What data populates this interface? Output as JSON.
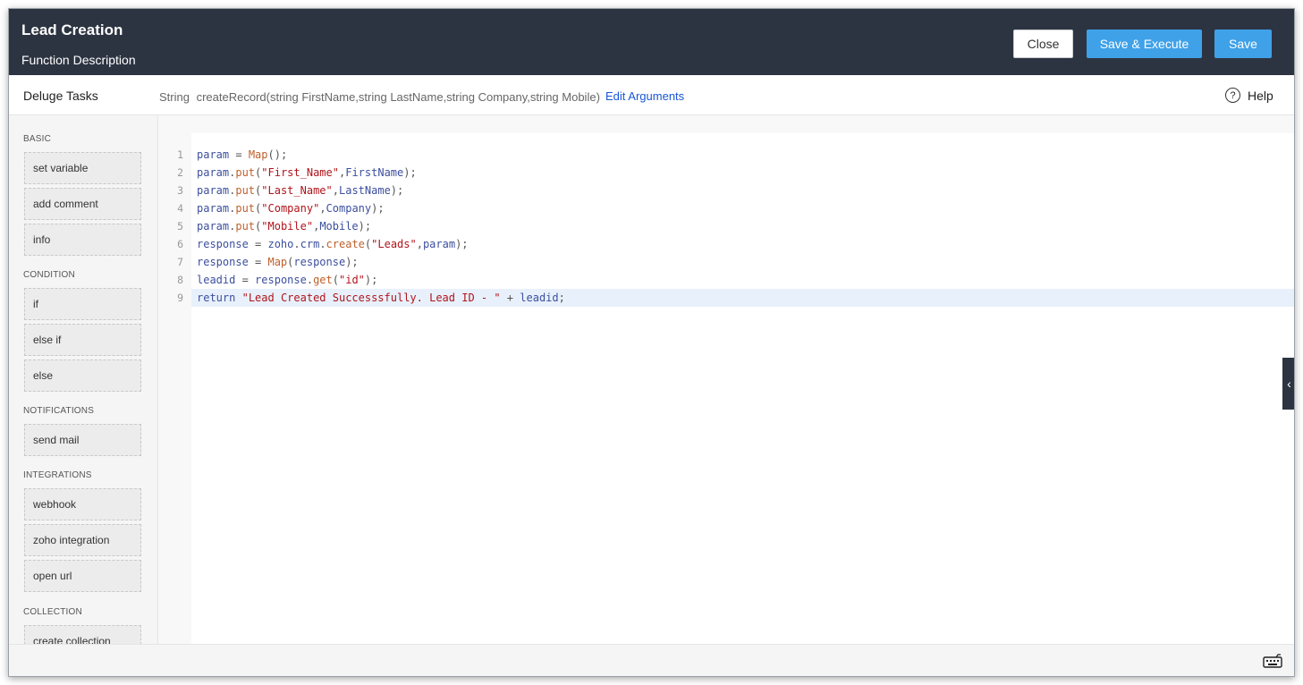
{
  "header": {
    "title": "Lead Creation",
    "subtitle": "Function Description",
    "close_label": "Close",
    "save_execute_label": "Save & Execute",
    "save_label": "Save"
  },
  "subbar": {
    "panel_title": "Deluge Tasks",
    "return_type": "String",
    "signature": "createRecord(string FirstName,string LastName,string Company,string Mobile)",
    "edit_arguments_label": "Edit Arguments",
    "help_label": "Help",
    "help_icon_glyph": "?"
  },
  "sidebar": {
    "groups": [
      {
        "title": "BASIC",
        "items": [
          "set variable",
          "add comment",
          "info"
        ]
      },
      {
        "title": "CONDITION",
        "items": [
          "if",
          "else if",
          "else"
        ]
      },
      {
        "title": "NOTIFICATIONS",
        "items": [
          "send mail"
        ]
      },
      {
        "title": "INTEGRATIONS",
        "items": [
          "webhook",
          "zoho integration",
          "open url"
        ]
      },
      {
        "title": "COLLECTION",
        "items": [
          "create collection"
        ]
      }
    ]
  },
  "editor": {
    "active_line": 9,
    "lines": [
      "param = Map();",
      "param.put(\"First_Name\",FirstName);",
      "param.put(\"Last_Name\",LastName);",
      "param.put(\"Company\",Company);",
      "param.put(\"Mobile\",Mobile);",
      "response = zoho.crm.create(\"Leads\",param);",
      "response = Map(response);",
      "leadid = response.get(\"id\");",
      "return \"Lead Created Successsfully. Lead ID - \" + leadid;"
    ]
  },
  "icons": {
    "collapse": "chevron-left-icon",
    "keyboard": "keyboard-icon",
    "help": "question-circle-icon"
  },
  "colors": {
    "header_bg": "#2d3441",
    "primary_button": "#3fa1e8",
    "link": "#1a56d6",
    "string_token": "#b0141b",
    "function_token": "#c0602c",
    "variable_token": "#3c4f9e"
  }
}
